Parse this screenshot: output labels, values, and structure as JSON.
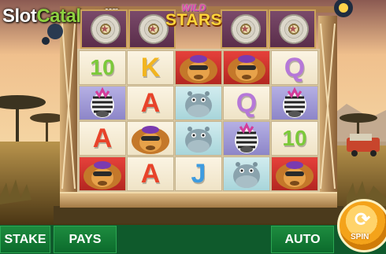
{
  "watermark": {
    "prefix": "Slot",
    "accent": "Catalog",
    "suffix": ".com"
  },
  "logo": {
    "line1": "WILD",
    "line2": "STARS"
  },
  "reels": {
    "rows": [
      [
        "10",
        "K",
        "lion",
        "lion",
        "Q"
      ],
      [
        "zebra",
        "A",
        "hippo",
        "Q",
        "zebra"
      ],
      [
        "A",
        "lion",
        "hippo",
        "zebra",
        "10"
      ],
      [
        "lion",
        "A",
        "J",
        "hippo",
        "lion"
      ]
    ]
  },
  "controls": {
    "stake": "STAKE",
    "pays": "PAYS",
    "auto": "AUTO",
    "spin": "SPIN"
  }
}
